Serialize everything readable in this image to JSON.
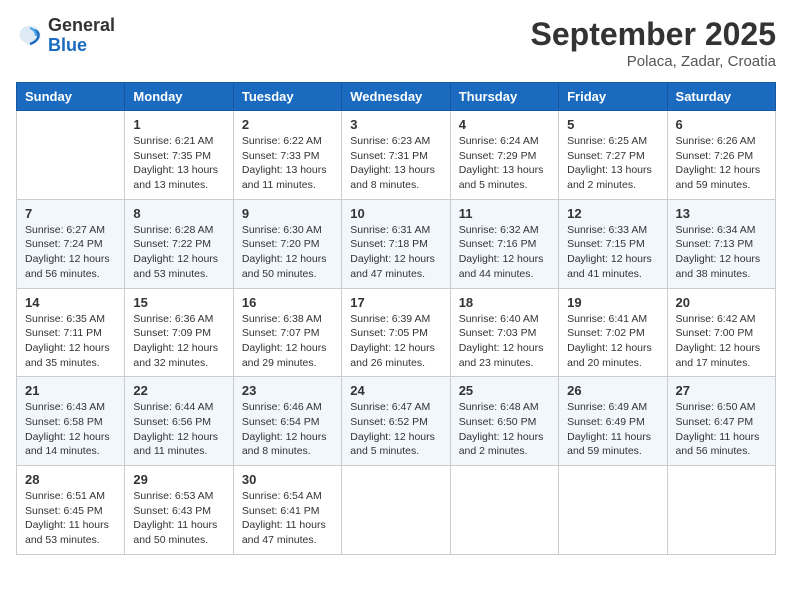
{
  "header": {
    "logo_general": "General",
    "logo_blue": "Blue",
    "month_title": "September 2025",
    "location": "Polaca, Zadar, Croatia"
  },
  "weekdays": [
    "Sunday",
    "Monday",
    "Tuesday",
    "Wednesday",
    "Thursday",
    "Friday",
    "Saturday"
  ],
  "weeks": [
    [
      {
        "day": "",
        "info": ""
      },
      {
        "day": "1",
        "info": "Sunrise: 6:21 AM\nSunset: 7:35 PM\nDaylight: 13 hours\nand 13 minutes."
      },
      {
        "day": "2",
        "info": "Sunrise: 6:22 AM\nSunset: 7:33 PM\nDaylight: 13 hours\nand 11 minutes."
      },
      {
        "day": "3",
        "info": "Sunrise: 6:23 AM\nSunset: 7:31 PM\nDaylight: 13 hours\nand 8 minutes."
      },
      {
        "day": "4",
        "info": "Sunrise: 6:24 AM\nSunset: 7:29 PM\nDaylight: 13 hours\nand 5 minutes."
      },
      {
        "day": "5",
        "info": "Sunrise: 6:25 AM\nSunset: 7:27 PM\nDaylight: 13 hours\nand 2 minutes."
      },
      {
        "day": "6",
        "info": "Sunrise: 6:26 AM\nSunset: 7:26 PM\nDaylight: 12 hours\nand 59 minutes."
      }
    ],
    [
      {
        "day": "7",
        "info": "Sunrise: 6:27 AM\nSunset: 7:24 PM\nDaylight: 12 hours\nand 56 minutes."
      },
      {
        "day": "8",
        "info": "Sunrise: 6:28 AM\nSunset: 7:22 PM\nDaylight: 12 hours\nand 53 minutes."
      },
      {
        "day": "9",
        "info": "Sunrise: 6:30 AM\nSunset: 7:20 PM\nDaylight: 12 hours\nand 50 minutes."
      },
      {
        "day": "10",
        "info": "Sunrise: 6:31 AM\nSunset: 7:18 PM\nDaylight: 12 hours\nand 47 minutes."
      },
      {
        "day": "11",
        "info": "Sunrise: 6:32 AM\nSunset: 7:16 PM\nDaylight: 12 hours\nand 44 minutes."
      },
      {
        "day": "12",
        "info": "Sunrise: 6:33 AM\nSunset: 7:15 PM\nDaylight: 12 hours\nand 41 minutes."
      },
      {
        "day": "13",
        "info": "Sunrise: 6:34 AM\nSunset: 7:13 PM\nDaylight: 12 hours\nand 38 minutes."
      }
    ],
    [
      {
        "day": "14",
        "info": "Sunrise: 6:35 AM\nSunset: 7:11 PM\nDaylight: 12 hours\nand 35 minutes."
      },
      {
        "day": "15",
        "info": "Sunrise: 6:36 AM\nSunset: 7:09 PM\nDaylight: 12 hours\nand 32 minutes."
      },
      {
        "day": "16",
        "info": "Sunrise: 6:38 AM\nSunset: 7:07 PM\nDaylight: 12 hours\nand 29 minutes."
      },
      {
        "day": "17",
        "info": "Sunrise: 6:39 AM\nSunset: 7:05 PM\nDaylight: 12 hours\nand 26 minutes."
      },
      {
        "day": "18",
        "info": "Sunrise: 6:40 AM\nSunset: 7:03 PM\nDaylight: 12 hours\nand 23 minutes."
      },
      {
        "day": "19",
        "info": "Sunrise: 6:41 AM\nSunset: 7:02 PM\nDaylight: 12 hours\nand 20 minutes."
      },
      {
        "day": "20",
        "info": "Sunrise: 6:42 AM\nSunset: 7:00 PM\nDaylight: 12 hours\nand 17 minutes."
      }
    ],
    [
      {
        "day": "21",
        "info": "Sunrise: 6:43 AM\nSunset: 6:58 PM\nDaylight: 12 hours\nand 14 minutes."
      },
      {
        "day": "22",
        "info": "Sunrise: 6:44 AM\nSunset: 6:56 PM\nDaylight: 12 hours\nand 11 minutes."
      },
      {
        "day": "23",
        "info": "Sunrise: 6:46 AM\nSunset: 6:54 PM\nDaylight: 12 hours\nand 8 minutes."
      },
      {
        "day": "24",
        "info": "Sunrise: 6:47 AM\nSunset: 6:52 PM\nDaylight: 12 hours\nand 5 minutes."
      },
      {
        "day": "25",
        "info": "Sunrise: 6:48 AM\nSunset: 6:50 PM\nDaylight: 12 hours\nand 2 minutes."
      },
      {
        "day": "26",
        "info": "Sunrise: 6:49 AM\nSunset: 6:49 PM\nDaylight: 11 hours\nand 59 minutes."
      },
      {
        "day": "27",
        "info": "Sunrise: 6:50 AM\nSunset: 6:47 PM\nDaylight: 11 hours\nand 56 minutes."
      }
    ],
    [
      {
        "day": "28",
        "info": "Sunrise: 6:51 AM\nSunset: 6:45 PM\nDaylight: 11 hours\nand 53 minutes."
      },
      {
        "day": "29",
        "info": "Sunrise: 6:53 AM\nSunset: 6:43 PM\nDaylight: 11 hours\nand 50 minutes."
      },
      {
        "day": "30",
        "info": "Sunrise: 6:54 AM\nSunset: 6:41 PM\nDaylight: 11 hours\nand 47 minutes."
      },
      {
        "day": "",
        "info": ""
      },
      {
        "day": "",
        "info": ""
      },
      {
        "day": "",
        "info": ""
      },
      {
        "day": "",
        "info": ""
      }
    ]
  ]
}
